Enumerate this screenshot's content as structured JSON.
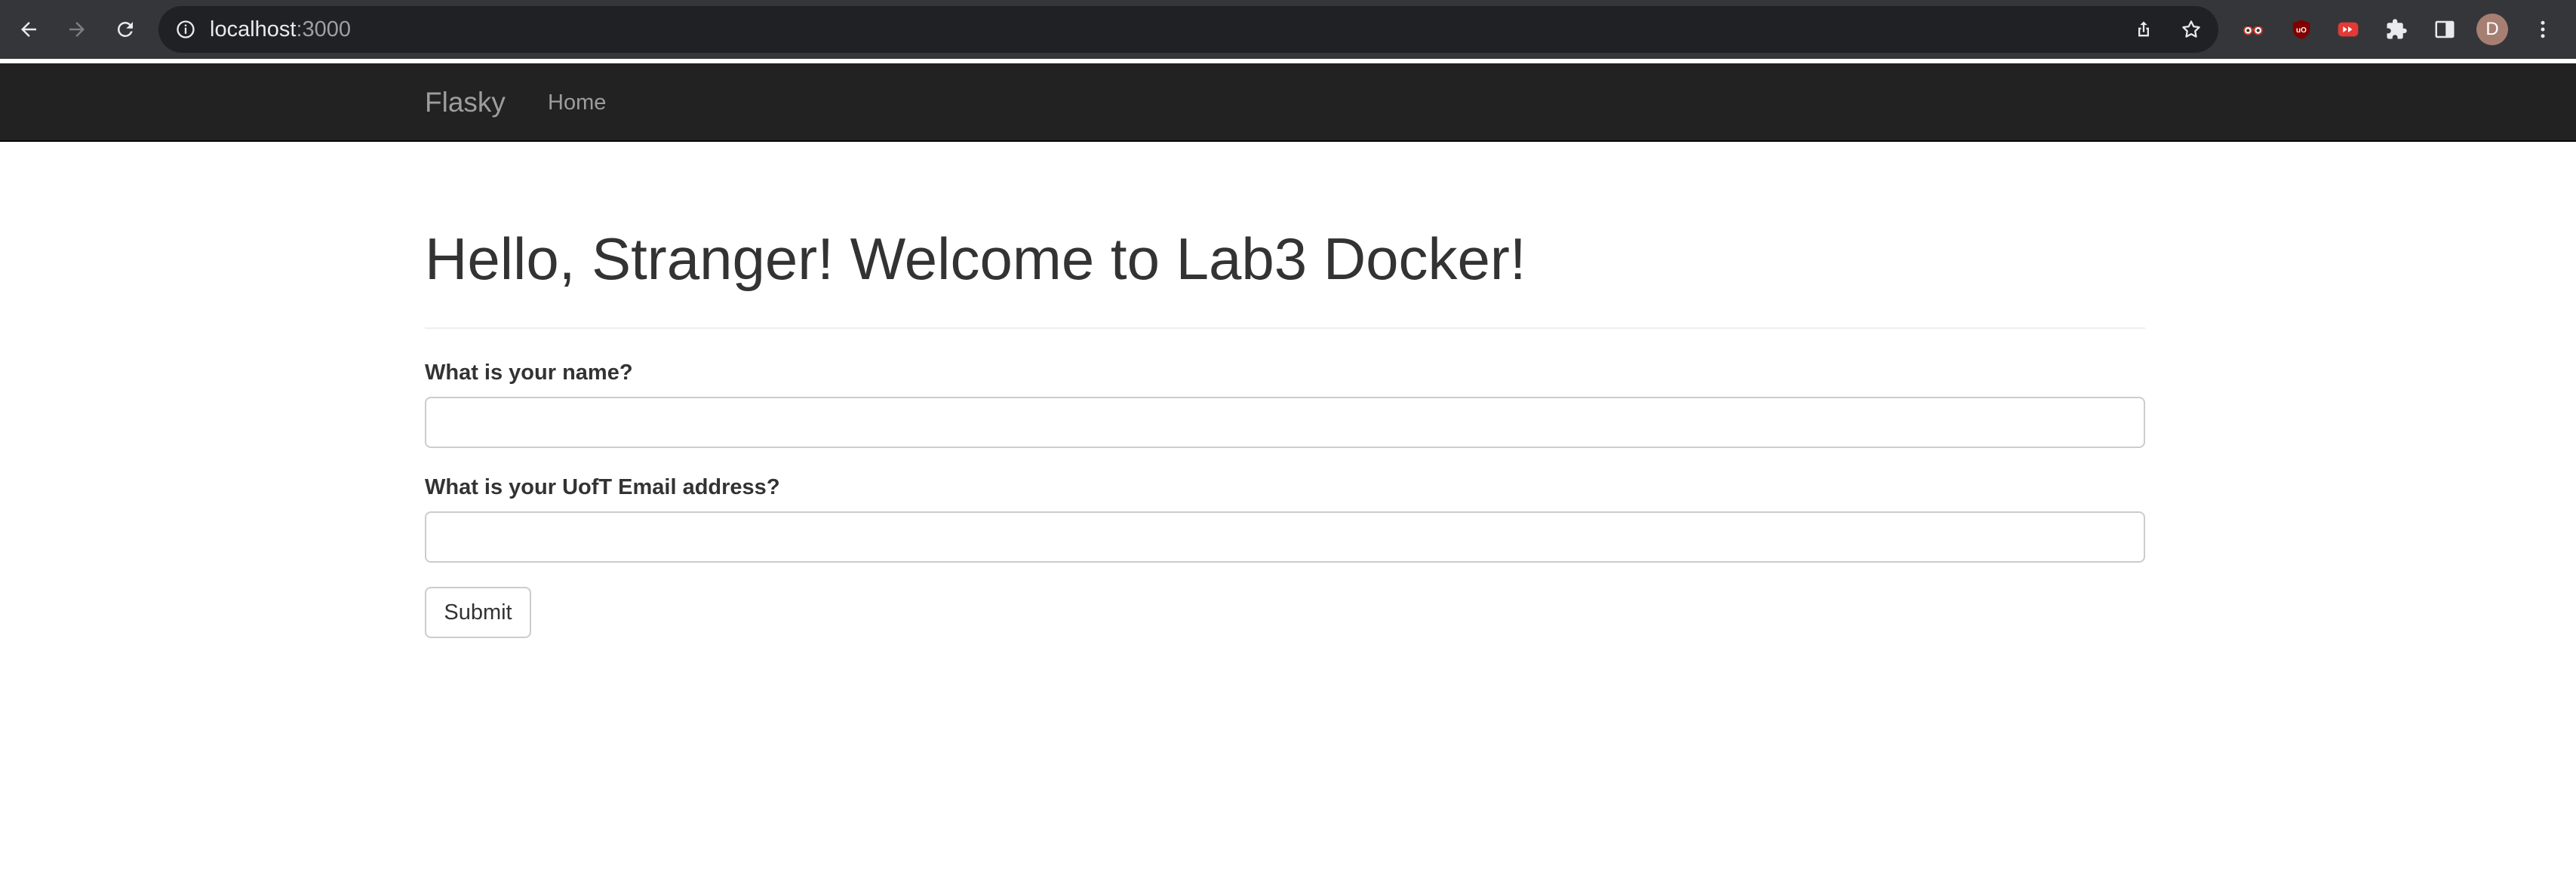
{
  "browser": {
    "url_host": "localhost",
    "url_port": ":3000",
    "avatar_letter": "D",
    "icons": {
      "back": "arrow-left-icon",
      "forward": "arrow-right-icon",
      "reload": "reload-icon",
      "info": "info-icon",
      "share": "share-icon",
      "bookmark": "star-icon",
      "extension_1": "glasses-icon",
      "extension_2": "ublock-icon",
      "extension_3": "fast-forward-icon",
      "extensions": "puzzle-icon",
      "side_panel": "side-panel-icon",
      "menu": "kebab-menu-icon"
    }
  },
  "navbar": {
    "brand": "Flasky",
    "items": [
      {
        "label": "Home"
      }
    ]
  },
  "page": {
    "title": "Hello, Stranger! Welcome to Lab3 Docker!"
  },
  "form": {
    "name_label": "What is your name?",
    "name_value": "",
    "email_label": "What is your UofT Email address?",
    "email_value": "",
    "submit_label": "Submit"
  },
  "colors": {
    "chrome_bg": "#35363a",
    "omnibox_bg": "#202124",
    "navbar_bg": "#222222",
    "navbar_text": "#9d9d9d",
    "heading_text": "#333333"
  }
}
